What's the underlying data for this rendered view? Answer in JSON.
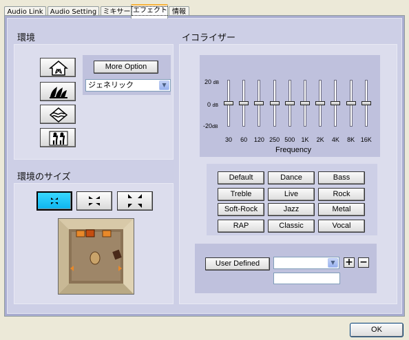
{
  "tabs": [
    {
      "label": "Audio Link",
      "active": false
    },
    {
      "label": "Audio Setting",
      "active": false
    },
    {
      "label": "ミキサー",
      "active": false
    },
    {
      "label": "エフェクト",
      "active": true
    },
    {
      "label": "情報",
      "active": false
    }
  ],
  "environment": {
    "title": "環境",
    "icons": [
      "house-icon",
      "opera-house-icon",
      "underwater-icon",
      "people-icon"
    ],
    "more_option_label": "More Option",
    "select_value": "ジェネリック"
  },
  "env_size": {
    "title": "環境のサイズ",
    "buttons": [
      "size-small-icon",
      "size-medium-icon",
      "size-large-icon"
    ],
    "active_index": 0
  },
  "equalizer": {
    "title": "イコライザー",
    "db_labels": {
      "top": "20",
      "mid": "0",
      "bottom": "-20",
      "unit": "dB"
    },
    "frequencies": [
      "30",
      "60",
      "120",
      "250",
      "500",
      "1K",
      "2K",
      "4K",
      "8K",
      "16K"
    ],
    "levels_db": [
      0,
      0,
      0,
      0,
      0,
      0,
      0,
      0,
      0,
      0
    ],
    "axis_label": "Frequency",
    "presets": [
      "Default",
      "Dance",
      "Bass",
      "Treble",
      "Live",
      "Rock",
      "Soft-Rock",
      "Jazz",
      "Metal",
      "RAP",
      "Classic",
      "Vocal"
    ],
    "user_defined_label": "User  Defined",
    "user_select_value": "",
    "user_name_value": "",
    "add_label": "+",
    "remove_label": "−"
  },
  "footer": {
    "ok_label": "OK"
  },
  "colors": {
    "panel": "#cdcfe6",
    "active_size": "#1ec5f5",
    "tab_highlight": "#f7b23a"
  }
}
